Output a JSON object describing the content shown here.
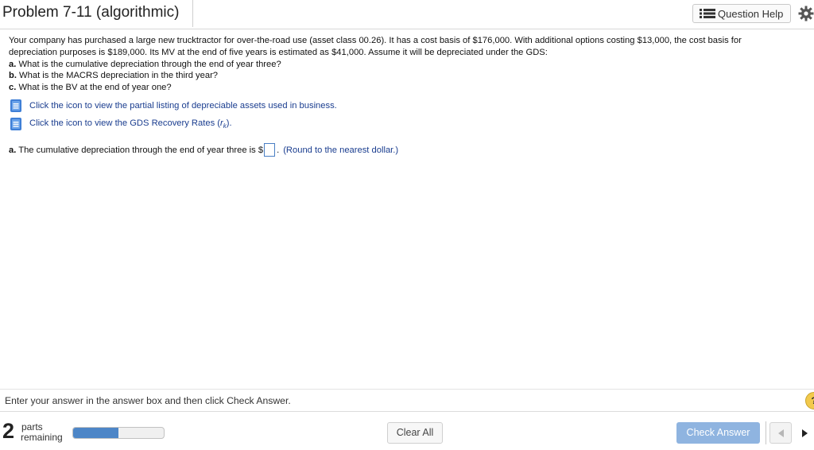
{
  "header": {
    "title": "Problem 7-11 (algorithmic)",
    "help_label": "Question Help",
    "help_icon": "list-icon",
    "settings_icon": "gear-icon"
  },
  "question": {
    "intro_line1": "Your company has purchased a large new trucktractor for over-the-road use (asset class 00.26). It has a cost basis of $176,000. With additional options costing $13,000, the cost basis for",
    "intro_line2": "depreciation purposes is $189,000. Its MV at the end of five years is estimated as $41,000. Assume it will be depreciated under the GDS:",
    "items": [
      {
        "letter": "a.",
        "text": " What is the cumulative depreciation through the end of year three?"
      },
      {
        "letter": "b.",
        "text": " What is the MACRS depreciation in the third year?"
      },
      {
        "letter": "c.",
        "text": " What is the BV at the end of year one?"
      }
    ],
    "links": [
      {
        "text": "Click the icon to view the partial listing of depreciable assets used in business.",
        "icon": "book-icon"
      },
      {
        "text_before": "Click the icon to view the GDS Recovery Rates (",
        "var": "r",
        "sub": "k",
        "text_after": ")."
      }
    ]
  },
  "answer": {
    "letter": "a.",
    "prompt": " The cumulative depreciation through the end of year three is $",
    "value": "",
    "after_box": ".",
    "hint": "(Round to the nearest dollar.)"
  },
  "footer": {
    "instruction": "Enter your answer in the answer box and then click Check Answer.",
    "help_symbol": "?",
    "parts_count": "2",
    "parts_word": "parts",
    "remaining_word": "remaining",
    "progress_fraction": 0.5,
    "clear_label": "Clear All",
    "check_label": "Check Answer",
    "colors": {
      "accent": "#4d86c7",
      "check_button": "#8fb4e0",
      "link": "#1a3d8f"
    }
  }
}
